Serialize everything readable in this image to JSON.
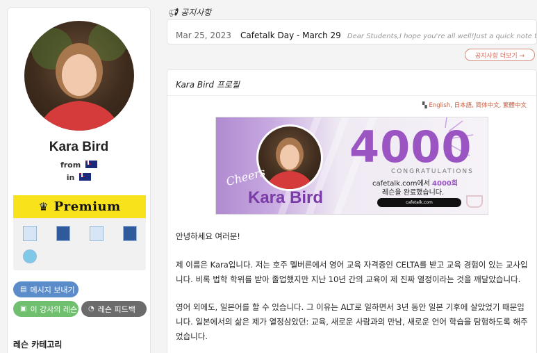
{
  "sidebar": {
    "name": "Kara Bird",
    "from_label": "from",
    "in_label": "in",
    "premium_label": "Premium",
    "buttons": {
      "message": "메시지 보내기",
      "lessons": "이 강사의 레슨",
      "feedback": "레슨 피드백"
    },
    "category_title": "레슨 카테고리"
  },
  "notice": {
    "header": "공지사항",
    "date": "Mar 25, 2023",
    "title": "Cafetalk Day - March 29",
    "snippet": "Dear Students,I hope you're all well!Just a quick note t...",
    "more_label": "공지사항 더보기 →"
  },
  "profile": {
    "header": "Kara Bird 프로필",
    "languages": [
      "English",
      "日本語",
      "简体中文",
      "繁體中文"
    ],
    "banner": {
      "number": "4000",
      "congrats": "CONGRATULATIONS",
      "site": "cafetalk.com에서",
      "count": "4000회",
      "completed": "레슨을 완료했습니다.",
      "url": "cafetalk.com",
      "cheers": "Cheers",
      "name": "Kara Bird"
    },
    "paragraphs": [
      "안녕하세요 여러분!",
      "제 이름은 Kara입니다. 저는 호주 멜버른에서 영어 교육 자격증인 CELTA를 받고 교육 경험이 있는 교사입니다. 비록 법학 학위를 받아 졸업했지만 지난 10년 간의 교육이 제 진짜 열정이라는 것을 깨달았습니다.",
      "영어 외에도, 일본어를 할 수 있습니다. 그 이유는 ALT로 일하면서 3년 동안 일본 기후에 살았었기 때문입니다. 일본에서의 삶은 제가 열정삼았던: 교육, 새로운 사람과의 만남, 새로운 언어 학습을 탐험하도록 해주었습니다."
    ]
  }
}
